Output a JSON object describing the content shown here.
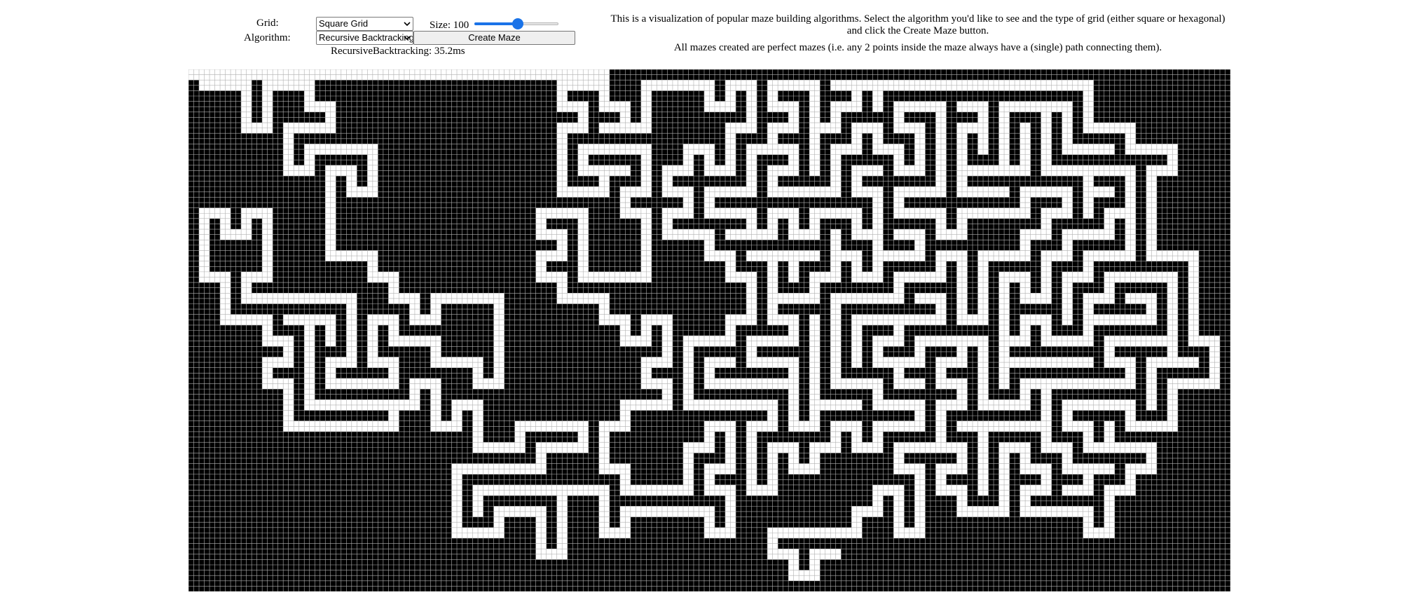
{
  "controls": {
    "grid_label": "Grid:",
    "grid_selected": "Square Grid",
    "algorithm_label": "Algorithm:",
    "algorithm_selected": "Recursive Backtracking",
    "size_label": "Size: 100",
    "size_value": 100,
    "size_fraction": 0.52,
    "create_button_label": "Create Maze",
    "timing_text": "RecursiveBacktracking: 35.2ms"
  },
  "description": {
    "line1": "This is a visualization of popular maze building algorithms. Select the algorithm you'd like to see and the type of grid (either square or hexagonal) and click the Create Maze button.",
    "line2": "All mazes created are perfect mazes (i.e. any 2 points inside the maze always have a (single) path connecting them)."
  },
  "colors": {
    "wall": "#000000",
    "passage": "#ffffff",
    "grid_line": "#b0b0b0",
    "slider_accent": "#1a73e8"
  },
  "icons": {
    "dropdown": "chevron-down-icon"
  }
}
